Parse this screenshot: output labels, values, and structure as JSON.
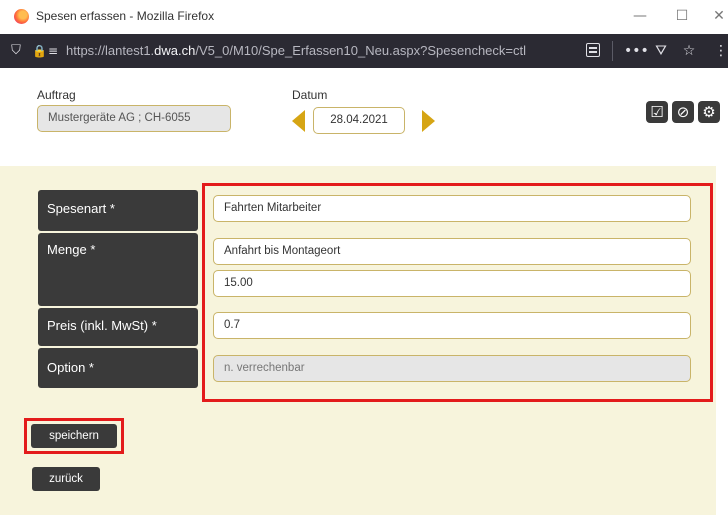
{
  "window": {
    "title": "Spesen erfassen - Mozilla Firefox",
    "minimize": "—",
    "maximize": "☐",
    "close": "✕"
  },
  "urlbar": {
    "url_prefix": "https://lantest1.",
    "url_domain": "dwa.ch",
    "url_path": "/V5_0/M10/Spe_Erfassen10_Neu.aspx?Spesencheck=ctl"
  },
  "header": {
    "auftrag_label": "Auftrag",
    "auftrag_value": "Mustergeräte AG ; CH-6055",
    "datum_label": "Datum",
    "datum_value": "28.04.2021"
  },
  "form": {
    "spesenart_label": "Spesenart *",
    "spesenart_value": "Fahrten Mitarbeiter",
    "menge_label": "Menge *",
    "menge_description": "Anfahrt bis Montageort",
    "menge_value": "15.00",
    "preis_label": "Preis (inkl. MwSt) *",
    "preis_value": "0.7",
    "option_label": "Option *",
    "option_value": "n. verrechenbar"
  },
  "buttons": {
    "save_label": "speichern",
    "back_label": "zurück"
  },
  "colors": {
    "accent": "#d6a514",
    "form_background": "#f7f4dc",
    "label_background": "#3a3a3a",
    "highlight": "#e31b1b"
  }
}
